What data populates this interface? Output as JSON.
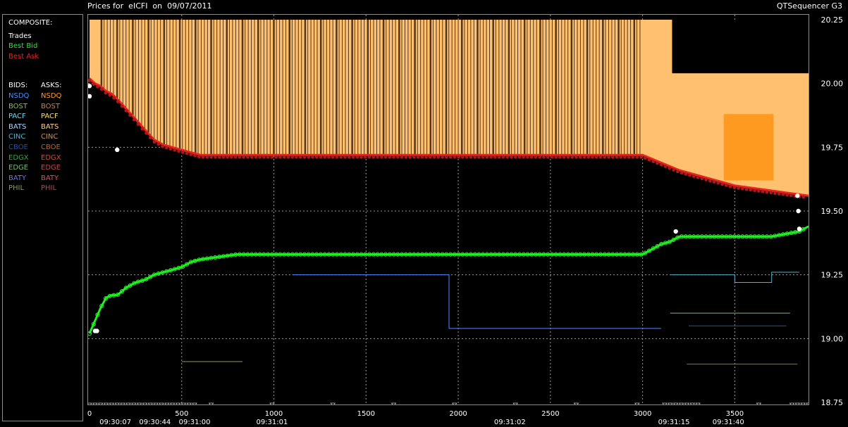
{
  "header": {
    "title": "Prices for  eICFI  on  09/07/2011",
    "app": "QTSequencer G3"
  },
  "legend": {
    "composite_label": "COMPOSITE:",
    "composite_items": [
      {
        "label": "Trades",
        "color": "#ffffff"
      },
      {
        "label": "Best Bid",
        "color": "#22ee22"
      },
      {
        "label": "Best Ask",
        "color": "#ee2222"
      }
    ],
    "bids_label": "BIDS:",
    "asks_label": "ASKS:",
    "bids": [
      {
        "label": "NSDQ",
        "color": "#4a8cff"
      },
      {
        "label": "BOST",
        "color": "#7ec850"
      },
      {
        "label": "PACF",
        "color": "#55e0ff"
      },
      {
        "label": "BATS",
        "color": "#aad4ff"
      },
      {
        "label": "CINC",
        "color": "#55b0c8"
      },
      {
        "label": "CBOE",
        "color": "#2850a0"
      },
      {
        "label": "EDGX",
        "color": "#40a040"
      },
      {
        "label": "EDGE",
        "color": "#70c070"
      },
      {
        "label": "BATY",
        "color": "#6a78e8"
      },
      {
        "label": "PHIL",
        "color": "#86a050"
      }
    ],
    "asks": [
      {
        "label": "NSDQ",
        "color": "#ff9a2a"
      },
      {
        "label": "BOST",
        "color": "#d08040"
      },
      {
        "label": "PACF",
        "color": "#ffe040"
      },
      {
        "label": "BATS",
        "color": "#ffd090"
      },
      {
        "label": "CINC",
        "color": "#c89060"
      },
      {
        "label": "CBOE",
        "color": "#b06830"
      },
      {
        "label": "EDGX",
        "color": "#c05040"
      },
      {
        "label": "EDGE",
        "color": "#c04848"
      },
      {
        "label": "BATY",
        "color": "#e05050"
      },
      {
        "label": "PHIL",
        "color": "#b84848"
      }
    ]
  },
  "chart_data": {
    "type": "line",
    "title": "Prices for  eICFI  on  09/07/2011",
    "xlim": [
      0,
      3900
    ],
    "ylim": [
      18.75,
      20.25
    ],
    "x_ticks": [
      0,
      500,
      1000,
      1500,
      2000,
      2500,
      3000,
      3500
    ],
    "y_ticks": [
      18.75,
      19.0,
      19.25,
      19.5,
      19.75,
      20.0,
      20.25
    ],
    "y_tick_labels": [
      "18.75",
      "19.00",
      "19.25",
      "19.50",
      "19.75",
      "20.00",
      "20.25"
    ],
    "time_labels": [
      {
        "x": 140,
        "label": "09:30:07"
      },
      {
        "x": 355,
        "label": "09:30:44"
      },
      {
        "x": 570,
        "label": "09:31:00"
      },
      {
        "x": 990,
        "label": "09:31:01"
      },
      {
        "x": 2280,
        "label": "09:31:02"
      },
      {
        "x": 3170,
        "label": "09:31:15"
      },
      {
        "x": 3465,
        "label": "09:31:40"
      }
    ],
    "grid": true,
    "series": [
      {
        "name": "Best Bid",
        "color": "#22ee22",
        "x": [
          0,
          30,
          60,
          90,
          120,
          150,
          200,
          250,
          300,
          350,
          400,
          450,
          500,
          550,
          600,
          700,
          800,
          900,
          1000,
          1500,
          2000,
          2500,
          3000,
          3050,
          3100,
          3150,
          3200,
          3300,
          3500,
          3700,
          3850,
          3900
        ],
        "y": [
          19.02,
          19.07,
          19.12,
          19.16,
          19.17,
          19.17,
          19.2,
          19.22,
          19.23,
          19.25,
          19.26,
          19.27,
          19.28,
          19.3,
          19.31,
          19.32,
          19.33,
          19.33,
          19.33,
          19.33,
          19.33,
          19.33,
          19.33,
          19.35,
          19.37,
          19.38,
          19.4,
          19.4,
          19.4,
          19.4,
          19.42,
          19.44
        ]
      },
      {
        "name": "Best Ask",
        "color": "#ee2222",
        "x": [
          0,
          30,
          60,
          90,
          120,
          150,
          200,
          250,
          300,
          350,
          400,
          450,
          500,
          550,
          600,
          800,
          1000,
          1500,
          2000,
          2500,
          3000,
          3100,
          3200,
          3300,
          3400,
          3500,
          3600,
          3700,
          3800,
          3900
        ],
        "y": [
          20.02,
          20.0,
          19.99,
          19.97,
          19.96,
          19.94,
          19.9,
          19.86,
          19.82,
          19.78,
          19.76,
          19.75,
          19.74,
          19.73,
          19.72,
          19.72,
          19.72,
          19.72,
          19.72,
          19.72,
          19.72,
          19.69,
          19.66,
          19.64,
          19.62,
          19.6,
          19.59,
          19.58,
          19.57,
          19.56
        ]
      },
      {
        "name": "Trades",
        "color": "#ffffff",
        "x": [
          0,
          0,
          30,
          40,
          150,
          3180,
          3840,
          3845,
          3850
        ],
        "y": [
          19.99,
          19.95,
          19.03,
          19.03,
          19.74,
          19.42,
          19.56,
          19.5,
          19.43
        ]
      }
    ]
  }
}
